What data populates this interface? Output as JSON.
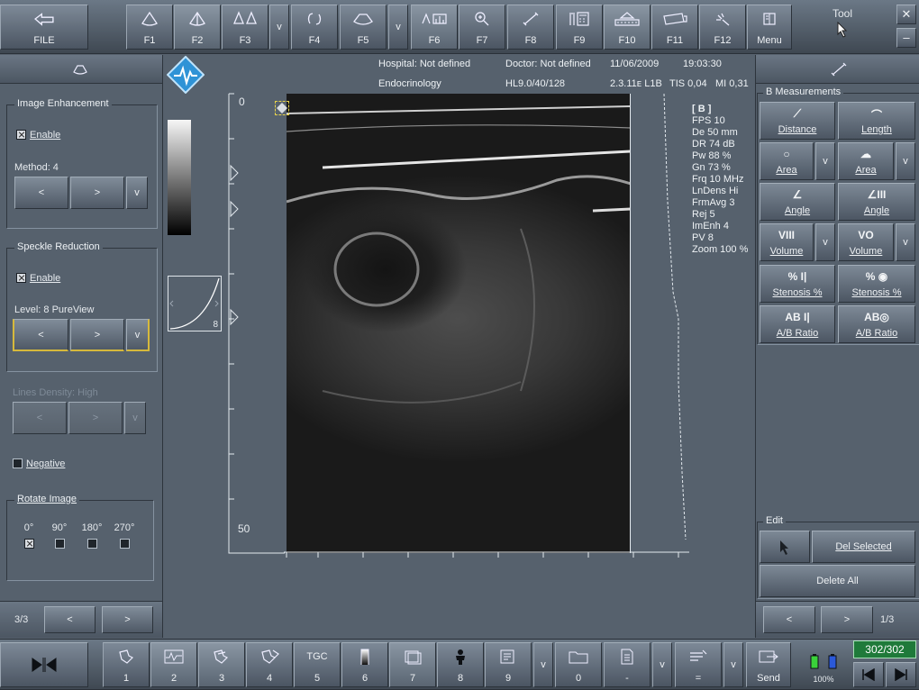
{
  "top_toolbar": {
    "file_label": "FILE",
    "f_keys": [
      "F1",
      "F2",
      "F3",
      "v",
      "F4",
      "F5",
      "v",
      "F6",
      "F7",
      "F8",
      "F9",
      "F10",
      "F11",
      "F12"
    ],
    "menu_label": "Menu",
    "tool_label": "Tool",
    "close_symbol": "✕",
    "minimize_symbol": "–"
  },
  "header": {
    "hospital": "Hospital: Not defined",
    "doctor": "Doctor: Not defined",
    "date": "11/06/2009",
    "time": "19:03:30",
    "exam": "Endocrinology",
    "probe": "HL9.0/40/128",
    "version": "2.3.11ᴇ L1B",
    "tis": "TIS 0,04",
    "mi": "MI 0,31"
  },
  "left_panel": {
    "image_enhancement": {
      "title": "Image Enhancement",
      "enable_label": "Enable",
      "method_label": "Method: 4",
      "prev": "<",
      "next": ">",
      "more": "v"
    },
    "speckle_reduction": {
      "title": "Speckle Reduction",
      "enable_label": "Enable",
      "level_label": "Level: 8 PureView",
      "prev": "<",
      "next": ">",
      "more": "v"
    },
    "lines_density": {
      "label": "Lines Density: High",
      "prev": "<",
      "next": ">",
      "more": "v"
    },
    "negative_label": "Negative",
    "rotate": {
      "title": "Rotate Image",
      "options": [
        "0°",
        "90°",
        "180°",
        "270°"
      ]
    },
    "pager": {
      "page": "3/3",
      "prev": "<",
      "next": ">"
    }
  },
  "image_area": {
    "depth_top": "0",
    "depth_bottom": "50",
    "curve_value": "8",
    "params_title": "[ B ]",
    "params": [
      "FPS  10",
      "De  50 mm",
      "DR  74 dB",
      "Pw  88 %",
      "Gn  73 %",
      "Frq  10 MHz",
      "LnDens  Hi",
      "FrmAvg  3",
      "Rej  5",
      "ImEnh  4",
      "PV  8",
      "Zoom  100 %"
    ]
  },
  "right_panel": {
    "title": "B Measurements",
    "buttons": [
      {
        "icon": "⟋",
        "label": "Distance"
      },
      {
        "icon": "⌒",
        "label": "Length"
      },
      {
        "icon": "○",
        "label": "Area"
      },
      {
        "icon": "☁",
        "label": "Area"
      },
      {
        "icon": "∠",
        "label": "Angle"
      },
      {
        "icon": "∠III",
        "label": "Angle"
      },
      {
        "icon": "VIII",
        "label": "Volume"
      },
      {
        "icon": "VO",
        "label": "Volume"
      },
      {
        "icon": "% I|",
        "label": "Stenosis %"
      },
      {
        "icon": "% ◉",
        "label": "Stenosis %"
      },
      {
        "icon": "AB I|",
        "label": "A/B Ratio"
      },
      {
        "icon": "AB◎",
        "label": "A/B Ratio"
      }
    ],
    "more": "v",
    "edit": {
      "title": "Edit",
      "del_selected": "Del Selected",
      "delete_all": "Delete All"
    },
    "pager": {
      "page": "1/3",
      "prev": "<",
      "next": ">"
    }
  },
  "bottom_toolbar": {
    "presets": [
      "1",
      "2",
      "3",
      "4",
      "5",
      "6",
      "7",
      "8",
      "9",
      "v",
      "0",
      "-",
      "v",
      "=",
      "v"
    ],
    "tgc_label": "TGC",
    "send_label": "Send",
    "battery": "100%",
    "frame_counter": "302/302"
  },
  "colors": {
    "accent_green": "#1f7a3a",
    "logo_blue": "#2f93d6"
  }
}
